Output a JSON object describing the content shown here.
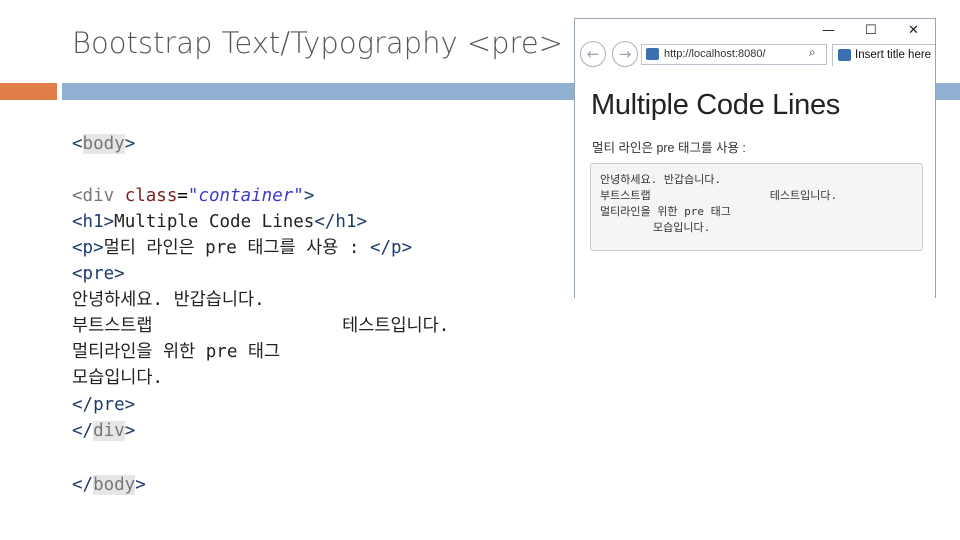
{
  "slide": {
    "title": "Bootstrap Text/Typography <pre>"
  },
  "code": {
    "body_open_lt": "<",
    "body_open_name": "body",
    "body_open_gt": ">",
    "div_open_a": "<div ",
    "div_attr": "class",
    "div_eq": "=",
    "div_val": "\"container\"",
    "div_gt": ">",
    "h1_line_open": "<h1>",
    "h1_text": "Multiple Code Lines",
    "h1_line_close": "</h1>",
    "p_open": "<p>",
    "p_text": "멀티 라인은 pre 태그를 사용 : ",
    "p_close": "</p>",
    "pre_open": "<pre>",
    "pre_line1": "안녕하세요. 반갑습니다.",
    "pre_line2": "부트스트랩                  테스트입니다.",
    "pre_line3": "멀티라인을 위한 pre 태그",
    "pre_line4": "모습입니다.",
    "pre_close": "</pre>",
    "div_close_lt": "</",
    "div_close_name": "div",
    "div_close_gt": ">",
    "body_close_lt": "</",
    "body_close_name": "body",
    "body_close_gt": ">"
  },
  "browser": {
    "minimize": "—",
    "maximize": "☐",
    "close": "✕",
    "back_icon": "←",
    "forward_icon": "→",
    "address": "http://localhost:8080/",
    "search_icon": "⌕",
    "tab_title": "Insert title here",
    "page": {
      "h1": "Multiple Code Lines",
      "p": "멀티 라인은 pre 태그를 사용 :",
      "pre": "안녕하세요. 반갑습니다.\n부트스트랩                  테스트입니다.\n멀티라인을 위한 pre 태그\n        모습입니다."
    }
  }
}
